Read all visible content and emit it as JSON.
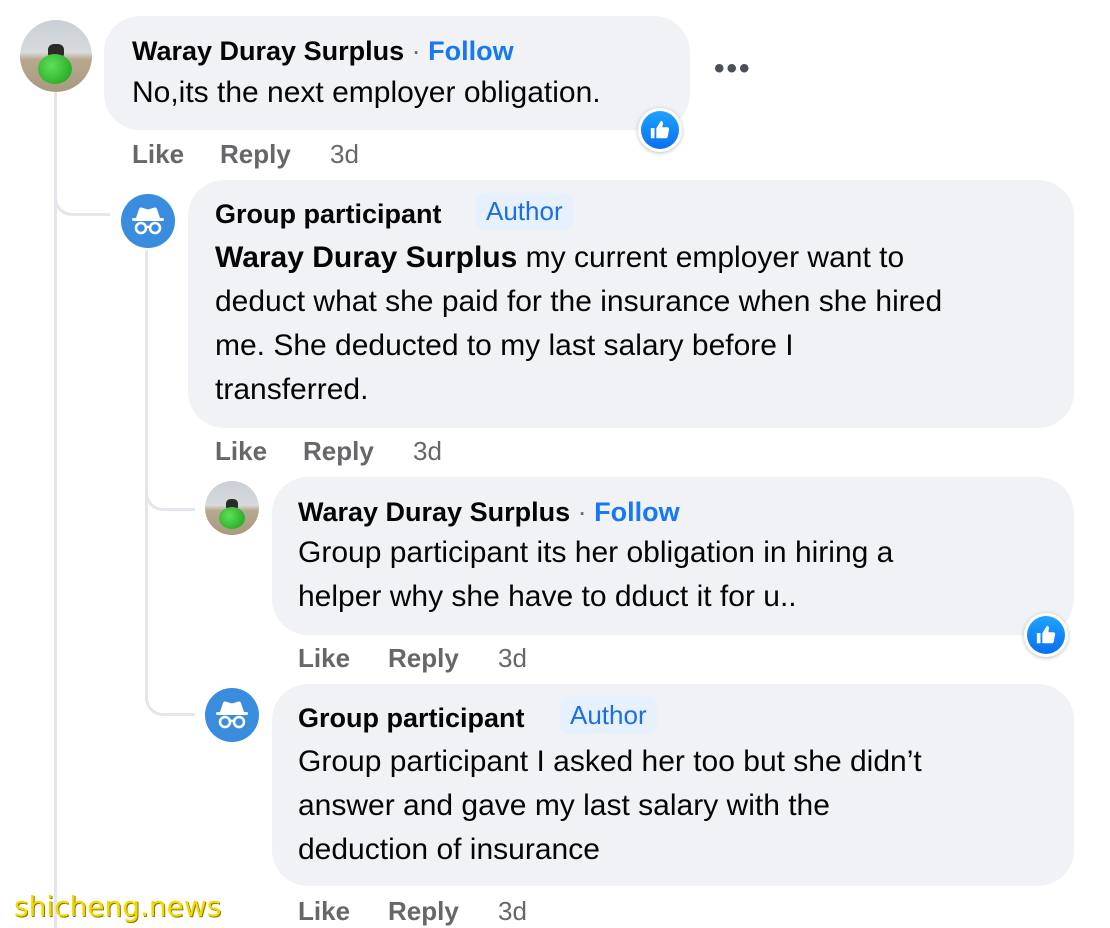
{
  "comments": [
    {
      "author": "Waray Duray Surplus",
      "separator": "·",
      "follow_label": "Follow",
      "text": "No,its the next employer obligation.",
      "has_like_reaction": true,
      "actions": {
        "like": "Like",
        "reply": "Reply",
        "time": "3d"
      },
      "more_icon": "more-horizontal-icon"
    },
    {
      "author": "Group participant",
      "badge": "Author",
      "mention": "Waray Duray Surplus",
      "text_lines": [
        " my current employer want to",
        "deduct what she paid for the insurance when she hired",
        "me. She deducted to my last salary before I",
        "transferred."
      ],
      "actions": {
        "like": "Like",
        "reply": "Reply",
        "time": "3d"
      }
    },
    {
      "author": "Waray Duray Surplus",
      "separator": "·",
      "follow_label": "Follow",
      "text_lines": [
        "Group participant its her obligation in hiring a",
        "helper why she have to dduct it for u.."
      ],
      "has_like_reaction": true,
      "actions": {
        "like": "Like",
        "reply": "Reply",
        "time": "3d"
      }
    },
    {
      "author": "Group participant",
      "badge": "Author",
      "text_lines": [
        "Group participant I asked her too but she didn’t",
        "answer and gave my last salary with the",
        "deduction of insurance"
      ],
      "actions": {
        "like": "Like",
        "reply": "Reply",
        "time": "3d"
      }
    }
  ],
  "watermark": "shicheng.news",
  "colors": {
    "link": "#1877f2",
    "bubble": "#f0f2f5",
    "meta": "#65676b",
    "badge_text": "#1b6ee5"
  }
}
